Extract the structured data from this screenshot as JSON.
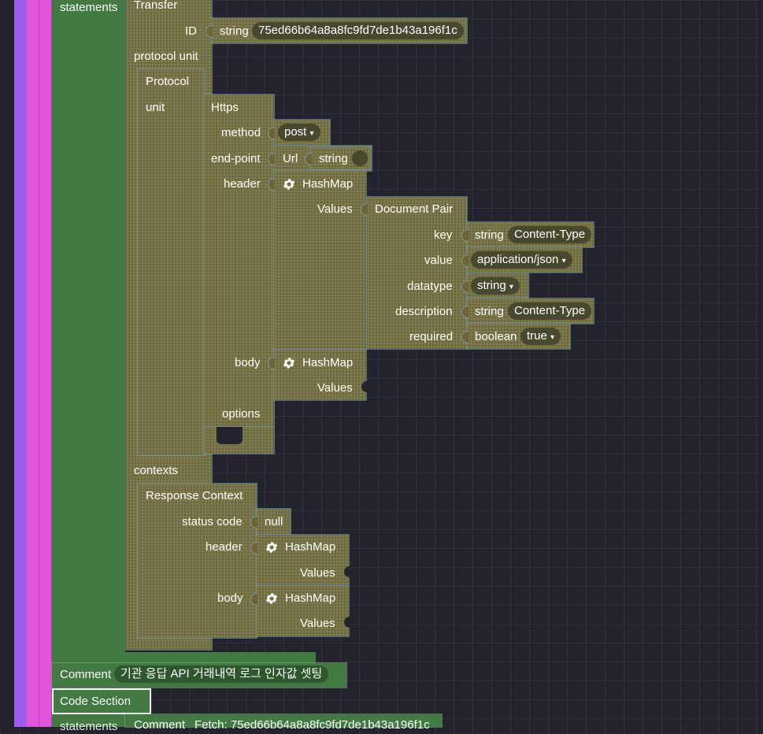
{
  "colors": {
    "canvas": "#22232c",
    "olive_block": "#7a7440",
    "green_block": "#437a44",
    "purple_stripe": "#a05bf0",
    "magenta_stripe": "#e255d8"
  },
  "statements_label": "statements",
  "transfer": {
    "title": "Transfer",
    "id_label": "ID",
    "id_type": "string",
    "id_value": "75ed66b64a8a8fc9fd7de1b43a196f1c"
  },
  "protocol_unit_label": "protocol unit",
  "protocol": {
    "title": "Protocol",
    "unit_label": "unit",
    "https": {
      "title": "Https",
      "method_label": "method",
      "method_value": "post",
      "endpoint_label": "end-point",
      "url_label": "Url",
      "url_type": "string",
      "header_label": "header",
      "header_map": {
        "title": "HashMap",
        "values_label": "Values",
        "pair": {
          "title": "Document Pair",
          "key_label": "key",
          "key_type": "string",
          "key_value": "Content-Type",
          "value_label": "value",
          "value_value": "application/json",
          "datatype_label": "datatype",
          "datatype_value": "string",
          "description_label": "description",
          "description_type": "string",
          "description_value": "Content-Type",
          "required_label": "required",
          "required_type": "boolean",
          "required_value": "true"
        }
      },
      "body_label": "body",
      "body_map": {
        "title": "HashMap",
        "values_label": "Values"
      },
      "options_label": "options"
    }
  },
  "contexts_label": "contexts",
  "response_context": {
    "title": "Response Context",
    "status_code_label": "status code",
    "status_code_value": "null",
    "header_label": "header",
    "header_map": {
      "title": "HashMap",
      "values_label": "Values"
    },
    "body_label": "body",
    "body_map": {
      "title": "HashMap",
      "values_label": "Values"
    }
  },
  "comment": {
    "label": "Comment",
    "text": "기관 응답 API 거래내역 로그 인자값 셋팅"
  },
  "code_section": {
    "label": "Code Section",
    "statements_label": "statements"
  },
  "fetch_comment": {
    "label": "Comment",
    "text": "Fetch: 75ed66b64a8a8fc9fd7de1b43a196f1c"
  },
  "icons": {
    "dropdown": "▾",
    "gear": "gear-icon"
  }
}
